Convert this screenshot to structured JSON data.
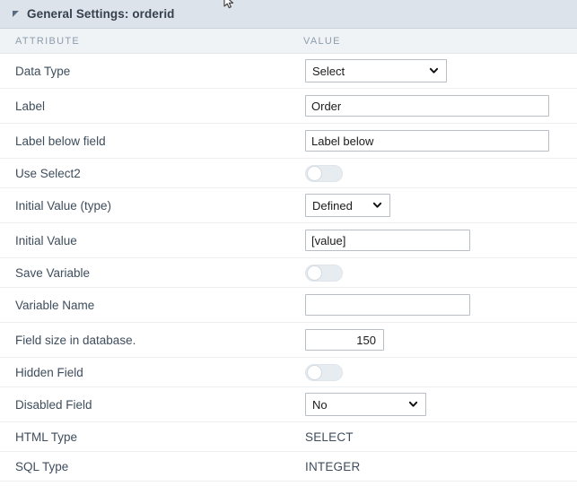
{
  "panel": {
    "title": "General Settings: orderid",
    "collapse_icon": "triangle-collapse-icon"
  },
  "columns": {
    "attribute": "ATTRIBUTE",
    "value": "VALUE"
  },
  "rows": [
    {
      "label": "Data Type",
      "control": "select",
      "value": "Select"
    },
    {
      "label": "Label",
      "control": "text",
      "value": "Order"
    },
    {
      "label": "Label below field",
      "control": "text",
      "value": "Label below"
    },
    {
      "label": "Use Select2",
      "control": "toggle",
      "value": "off"
    },
    {
      "label": "Initial Value (type)",
      "control": "select",
      "value": "Defined"
    },
    {
      "label": "Initial Value",
      "control": "text",
      "value": "[value]"
    },
    {
      "label": "Save Variable",
      "control": "toggle",
      "value": "off"
    },
    {
      "label": "Variable Name",
      "control": "text",
      "value": ""
    },
    {
      "label": "Field size in database.",
      "control": "number",
      "value": "150"
    },
    {
      "label": "Hidden Field",
      "control": "toggle",
      "value": "off"
    },
    {
      "label": "Disabled Field",
      "control": "select",
      "value": "No"
    },
    {
      "label": "HTML Type",
      "control": "static",
      "value": "SELECT"
    },
    {
      "label": "SQL Type",
      "control": "static",
      "value": "INTEGER"
    }
  ]
}
